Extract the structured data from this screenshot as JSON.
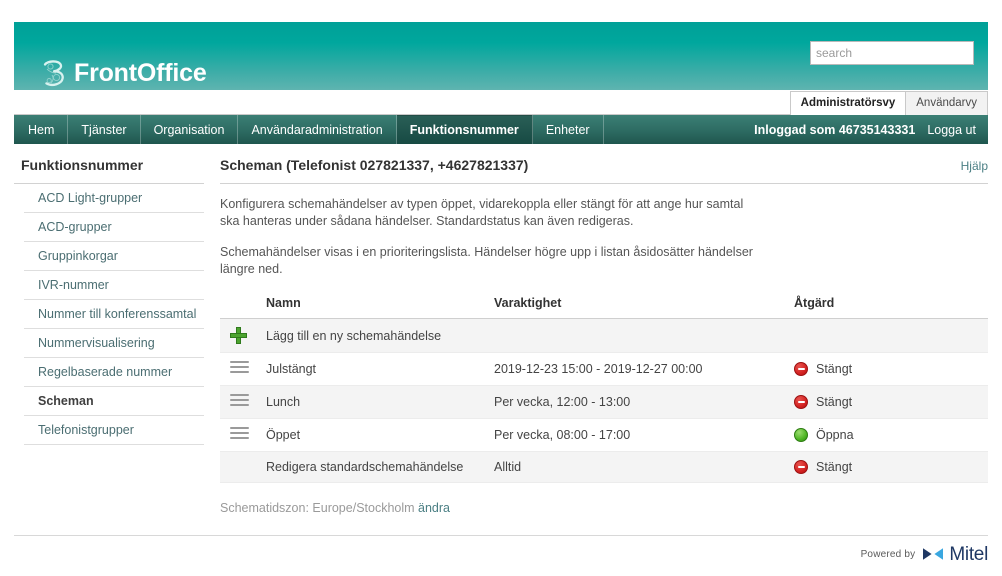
{
  "colors": {
    "banner_teal": "#00a79d",
    "nav_green": "#2d6b62",
    "link_teal": "#4b7f84",
    "status_closed": "#d21f1f",
    "status_open": "#4eb524",
    "add_green": "#4ca32f",
    "mitel_blue": "#1f3864"
  },
  "banner": {
    "brand_name": "FrontOffice",
    "logo_icon": "three-logo-icon"
  },
  "search": {
    "value": "",
    "placeholder": "search",
    "icon": "search-icon"
  },
  "view_tabs": [
    {
      "label": "Administratörsvy",
      "active": true
    },
    {
      "label": "Användarvy",
      "active": false
    }
  ],
  "main_nav": {
    "items": [
      {
        "label": "Hem",
        "active": false
      },
      {
        "label": "Tjänster",
        "active": false
      },
      {
        "label": "Organisation",
        "active": false
      },
      {
        "label": "Användaradministration",
        "active": false
      },
      {
        "label": "Funktionsnummer",
        "active": true
      },
      {
        "label": "Enheter",
        "active": false
      }
    ],
    "logged_in_as": "Inloggad som 46735143331",
    "logout_label": "Logga ut"
  },
  "sidebar": {
    "title": "Funktionsnummer",
    "items": [
      {
        "label": "ACD Light-grupper",
        "active": false
      },
      {
        "label": "ACD-grupper",
        "active": false
      },
      {
        "label": "Gruppinkorgar",
        "active": false
      },
      {
        "label": "IVR-nummer",
        "active": false
      },
      {
        "label": "Nummer till konferenssamtal",
        "active": false
      },
      {
        "label": "Nummervisualisering",
        "active": false
      },
      {
        "label": "Regelbaserade nummer",
        "active": false
      },
      {
        "label": "Scheman",
        "active": true
      },
      {
        "label": "Telefonistgrupper",
        "active": false
      }
    ]
  },
  "main": {
    "title": "Scheman (Telefonist 027821337, +4627821337)",
    "help_label": "Hjälp",
    "intro_1": "Konfigurera schemahändelser av typen öppet, vidarekoppla eller stängt för att ange hur samtal ska hanteras under sådana händelser. Standardstatus kan även redigeras.",
    "intro_2": "Schemahändelser visas i en prioriteringslista. Händelser högre upp i listan åsidosätter händelser längre ned.",
    "table": {
      "headers": {
        "handle": "",
        "name": "Namn",
        "duration": "Varaktighet",
        "action": "Åtgärd"
      },
      "add_row": {
        "icon": "plus-icon",
        "label": "Lägg till en ny schemahändelse"
      },
      "rows": [
        {
          "handle_icon": "drag-handle-icon",
          "has_handle": true,
          "name": "Julstängt",
          "duration": "2019-12-23 15:00 - 2019-12-27 00:00",
          "status_icon": "no-entry-icon",
          "status": "Stängt",
          "status_type": "closed"
        },
        {
          "handle_icon": "drag-handle-icon",
          "has_handle": true,
          "name": "Lunch",
          "duration": "Per vecka, 12:00 - 13:00",
          "status_icon": "no-entry-icon",
          "status": "Stängt",
          "status_type": "closed"
        },
        {
          "handle_icon": "drag-handle-icon",
          "has_handle": true,
          "name": "Öppet",
          "duration": "Per vecka, 08:00 - 17:00",
          "status_icon": "green-circle-icon",
          "status": "Öppna",
          "status_type": "open"
        },
        {
          "handle_icon": "",
          "has_handle": false,
          "name": "Redigera standardschemahändelse",
          "duration": "Alltid",
          "status_icon": "no-entry-icon",
          "status": "Stängt",
          "status_type": "closed"
        }
      ]
    },
    "timezone_label": "Schematidszon: Europe/Stockholm",
    "timezone_change_link": "ändra"
  },
  "footer": {
    "powered_by": "Powered by",
    "vendor": "Mitel",
    "vendor_icon": "mitel-bowtie-icon"
  }
}
